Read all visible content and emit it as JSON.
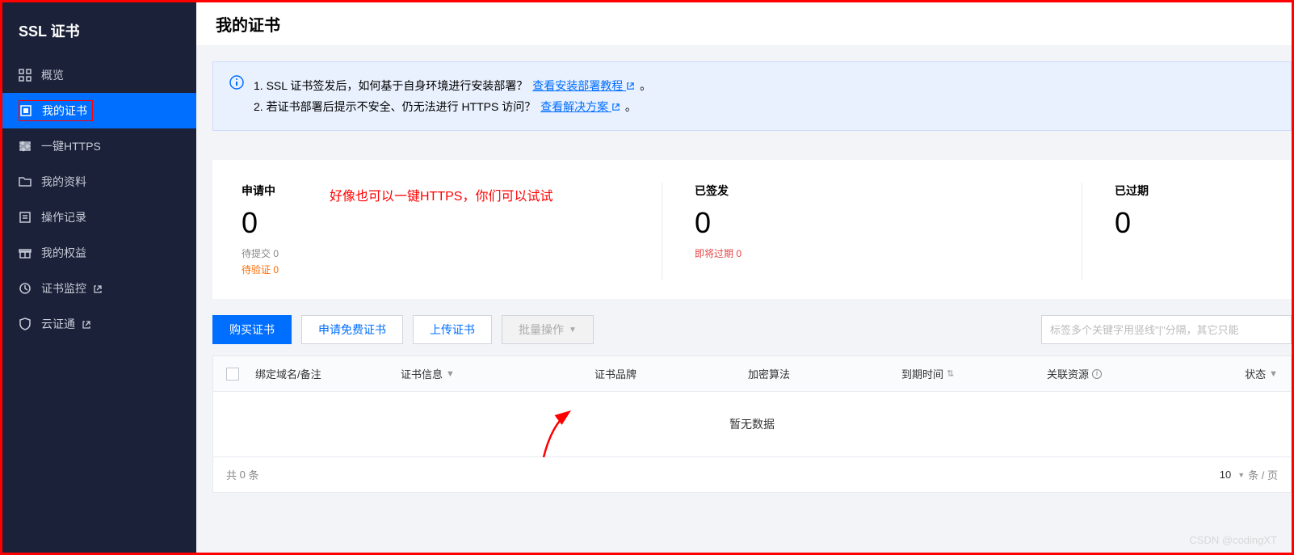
{
  "sidebar": {
    "title": "SSL 证书",
    "items": [
      {
        "key": "overview",
        "label": "概览",
        "icon": "grid-icon"
      },
      {
        "key": "my-certs",
        "label": "我的证书",
        "icon": "square-icon"
      },
      {
        "key": "one-https",
        "label": "一键HTTPS",
        "icon": "settings-icon"
      },
      {
        "key": "my-profile",
        "label": "我的资料",
        "icon": "folder-icon"
      },
      {
        "key": "op-log",
        "label": "操作记录",
        "icon": "list-icon"
      },
      {
        "key": "my-rights",
        "label": "我的权益",
        "icon": "gift-icon"
      },
      {
        "key": "cert-mon",
        "label": "证书监控",
        "icon": "monitor-icon",
        "external": true
      },
      {
        "key": "yunzhengtong",
        "label": "云证通",
        "icon": "shield-icon",
        "external": true
      }
    ],
    "active_key": "my-certs"
  },
  "page": {
    "title": "我的证书"
  },
  "info_box": {
    "line1_prefix": "1. SSL 证书签发后，如何基于自身环境进行安装部署？",
    "line1_link": "查看安装部署教程",
    "line1_suffix": "。",
    "line2_prefix": "2. 若证书部署后提示不安全、仍无法进行 HTTPS 访问？",
    "line2_link": "查看解决方案",
    "line2_suffix": "。"
  },
  "annotation": "好像也可以一键HTTPS，你们可以试试",
  "stats": {
    "applying": {
      "label": "申请中",
      "value": "0",
      "sub1": "待提交 0",
      "sub2": "待验证 0"
    },
    "issued": {
      "label": "已签发",
      "value": "0",
      "sub1": "即将过期 0"
    },
    "expired": {
      "label": "已过期",
      "value": "0"
    }
  },
  "toolbar": {
    "buy": "购买证书",
    "apply_free": "申请免费证书",
    "upload": "上传证书",
    "batch": "批量操作",
    "search_placeholder": "标签多个关键字用竖线\"|\"分隔，其它只能"
  },
  "table": {
    "headers": {
      "domain": "绑定域名/备注",
      "info": "证书信息",
      "brand": "证书品牌",
      "algo": "加密算法",
      "expire": "到期时间",
      "related": "关联资源",
      "status": "状态"
    },
    "empty": "暂无数据",
    "footer_prefix": "共",
    "footer_count": "0",
    "footer_suffix": "条",
    "page_size": "10",
    "page_size_suffix": "条 / 页"
  },
  "watermark": "CSDN @codingXT"
}
